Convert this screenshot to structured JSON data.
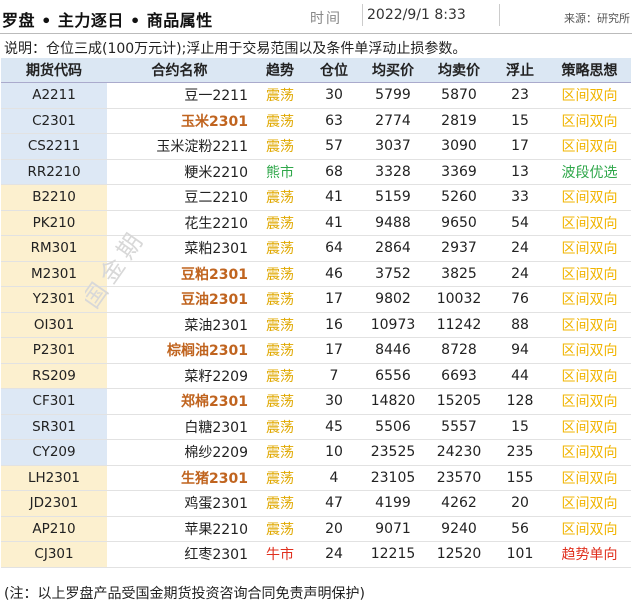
{
  "header": {
    "title": "罗盘 • 主力逐日 • 商品属性",
    "time_label": "时间",
    "time_value": "2022/9/1 8:33",
    "source": "来源：研究所"
  },
  "note": "说明：仓位三成(100万元计);浮止用于交易范围以及条件单浮动止损参数。",
  "columns": [
    "期货代码",
    "合约名称",
    "趋势",
    "仓位",
    "均买价",
    "均卖价",
    "浮止",
    "策略思想"
  ],
  "rows": [
    {
      "code": "A2211",
      "name": "豆一2211",
      "trend": "震荡",
      "pos": "30",
      "buy": "5799",
      "sell": "5870",
      "stop": "23",
      "strategy": "区间双向"
    },
    {
      "code": "C2301",
      "name": "玉米2301",
      "trend": "震荡",
      "pos": "63",
      "buy": "2774",
      "sell": "2819",
      "stop": "15",
      "strategy": "区间双向"
    },
    {
      "code": "CS2211",
      "name": "玉米淀粉2211",
      "trend": "震荡",
      "pos": "57",
      "buy": "3037",
      "sell": "3090",
      "stop": "17",
      "strategy": "区间双向"
    },
    {
      "code": "RR2210",
      "name": "粳米2210",
      "trend": "熊市",
      "pos": "68",
      "buy": "3328",
      "sell": "3369",
      "stop": "13",
      "strategy": "波段优选"
    },
    {
      "code": "B2210",
      "name": "豆二2210",
      "trend": "震荡",
      "pos": "41",
      "buy": "5159",
      "sell": "5260",
      "stop": "33",
      "strategy": "区间双向"
    },
    {
      "code": "PK210",
      "name": "花生2210",
      "trend": "震荡",
      "pos": "41",
      "buy": "9488",
      "sell": "9650",
      "stop": "54",
      "strategy": "区间双向"
    },
    {
      "code": "RM301",
      "name": "菜粕2301",
      "trend": "震荡",
      "pos": "64",
      "buy": "2864",
      "sell": "2937",
      "stop": "24",
      "strategy": "区间双向"
    },
    {
      "code": "M2301",
      "name": "豆粕2301",
      "trend": "震荡",
      "pos": "46",
      "buy": "3752",
      "sell": "3825",
      "stop": "24",
      "strategy": "区间双向"
    },
    {
      "code": "Y2301",
      "name": "豆油2301",
      "trend": "震荡",
      "pos": "17",
      "buy": "9802",
      "sell": "10032",
      "stop": "76",
      "strategy": "区间双向"
    },
    {
      "code": "OI301",
      "name": "菜油2301",
      "trend": "震荡",
      "pos": "16",
      "buy": "10973",
      "sell": "11242",
      "stop": "88",
      "strategy": "区间双向"
    },
    {
      "code": "P2301",
      "name": "棕榈油2301",
      "trend": "震荡",
      "pos": "17",
      "buy": "8446",
      "sell": "8728",
      "stop": "94",
      "strategy": "区间双向"
    },
    {
      "code": "RS209",
      "name": "菜籽2209",
      "trend": "震荡",
      "pos": "7",
      "buy": "6556",
      "sell": "6693",
      "stop": "44",
      "strategy": "区间双向"
    },
    {
      "code": "CF301",
      "name": "郑棉2301",
      "trend": "震荡",
      "pos": "30",
      "buy": "14820",
      "sell": "15205",
      "stop": "128",
      "strategy": "区间双向"
    },
    {
      "code": "SR301",
      "name": "白糖2301",
      "trend": "震荡",
      "pos": "45",
      "buy": "5506",
      "sell": "5557",
      "stop": "15",
      "strategy": "区间双向"
    },
    {
      "code": "CY209",
      "name": "棉纱2209",
      "trend": "震荡",
      "pos": "10",
      "buy": "23525",
      "sell": "24230",
      "stop": "235",
      "strategy": "区间双向"
    },
    {
      "code": "LH2301",
      "name": "生猪2301",
      "trend": "震荡",
      "pos": "4",
      "buy": "23105",
      "sell": "23570",
      "stop": "155",
      "strategy": "区间双向"
    },
    {
      "code": "JD2301",
      "name": "鸡蛋2301",
      "trend": "震荡",
      "pos": "47",
      "buy": "4199",
      "sell": "4262",
      "stop": "20",
      "strategy": "区间双向"
    },
    {
      "code": "AP210",
      "name": "苹果2210",
      "trend": "震荡",
      "pos": "20",
      "buy": "9071",
      "sell": "9240",
      "stop": "56",
      "strategy": "区间双向"
    },
    {
      "code": "CJ301",
      "name": "红枣2301",
      "trend": "牛市",
      "pos": "24",
      "buy": "12215",
      "sell": "12520",
      "stop": "101",
      "strategy": "趋势单向"
    }
  ],
  "highlight_names": [
    "玉米2301",
    "豆粕2301",
    "豆油2301",
    "棕榈油2301",
    "郑棉2301",
    "生猪2301"
  ],
  "code_band_colors": {
    "blue": "#dde8f5",
    "yellow": "#fcf0cf"
  },
  "code_bands": [
    "blue",
    "blue",
    "blue",
    "blue",
    "yellow",
    "yellow",
    "yellow",
    "yellow",
    "yellow",
    "yellow",
    "yellow",
    "yellow",
    "blue",
    "blue",
    "blue",
    "yellow",
    "yellow",
    "yellow",
    "yellow"
  ],
  "trend_colors": {
    "震荡": "#e0a800",
    "熊市": "#2fa74a",
    "牛市": "#e0301e"
  },
  "strategy_colors": {
    "区间双向": "#f1b400",
    "波段优选": "#2fa74a",
    "趋势单向": "#e0301e"
  },
  "watermark": "国金期",
  "footer": "(注：以上罗盘产品受国金期货投资咨询合同免责声明保护)"
}
